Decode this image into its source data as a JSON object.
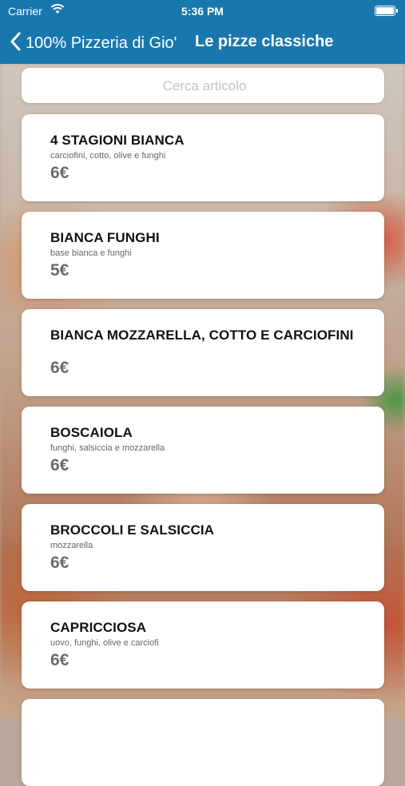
{
  "status_bar": {
    "carrier": "Carrier",
    "time": "5:36 PM"
  },
  "nav": {
    "back_label": "100% Pizzeria di Gio'",
    "title": "Le pizze classiche"
  },
  "search": {
    "placeholder": "Cerca articolo",
    "value": ""
  },
  "items": [
    {
      "name": "4 STAGIONI BIANCA",
      "description": "carciofini, cotto, olive e funghi",
      "price": "6€"
    },
    {
      "name": "BIANCA FUNGHI",
      "description": "base bianca e funghi",
      "price": "5€"
    },
    {
      "name": "BIANCA MOZZARELLA, COTTO E CARCIOFINI",
      "description": "",
      "price": "6€"
    },
    {
      "name": "BOSCAIOLA",
      "description": "funghi, salsiccia e mozzarella",
      "price": "6€"
    },
    {
      "name": "BROCCOLI E SALSICCIA",
      "description": "mozzarella",
      "price": "6€"
    },
    {
      "name": "CAPRICCIOSA",
      "description": "uovo, funghi, olive e carciofi",
      "price": "6€"
    }
  ],
  "colors": {
    "accent": "#1878ae",
    "price": "#6b6b6b"
  }
}
